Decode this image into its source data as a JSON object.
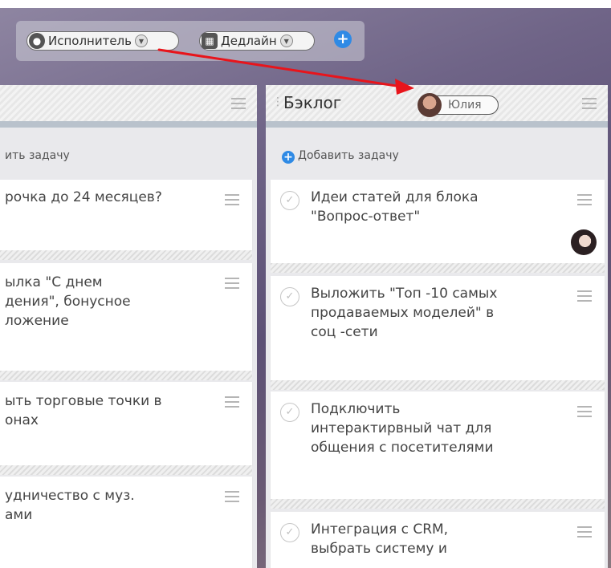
{
  "filter_bar": {
    "assignee_label": "Исполнитель",
    "deadline_label": "Дедлайн"
  },
  "left_column": {
    "add_task_label": "ить задачу",
    "cards": [
      {
        "lines": [
          "рочка до 24 месяцев?"
        ]
      },
      {
        "lines": [
          "ылка \"С днем",
          "дения\", бонусное",
          "ложение"
        ]
      },
      {
        "lines": [
          "ыть торговые точки в",
          "онах"
        ]
      },
      {
        "lines": [
          "удничество с муз.",
          "ами"
        ]
      }
    ]
  },
  "right_column": {
    "title": "Бэклог",
    "user_chip": "Юлия",
    "add_task_label": "Добавить задачу",
    "cards": [
      {
        "lines": [
          "Идеи статей для блока",
          "\"Вопрос-ответ\""
        ]
      },
      {
        "lines": [
          "Выложить \"Топ -10 самых",
          "продаваемых моделей\" в",
          "соц -сети"
        ]
      },
      {
        "lines": [
          "Подключить",
          "интерактирвный чат для",
          "общения с посетителями"
        ]
      },
      {
        "lines": [
          "Интеграция с CRM,",
          "выбрать систему и"
        ]
      }
    ]
  },
  "colors": {
    "accent": "#2f8ae5",
    "annotation_arrow": "#e8141b"
  }
}
